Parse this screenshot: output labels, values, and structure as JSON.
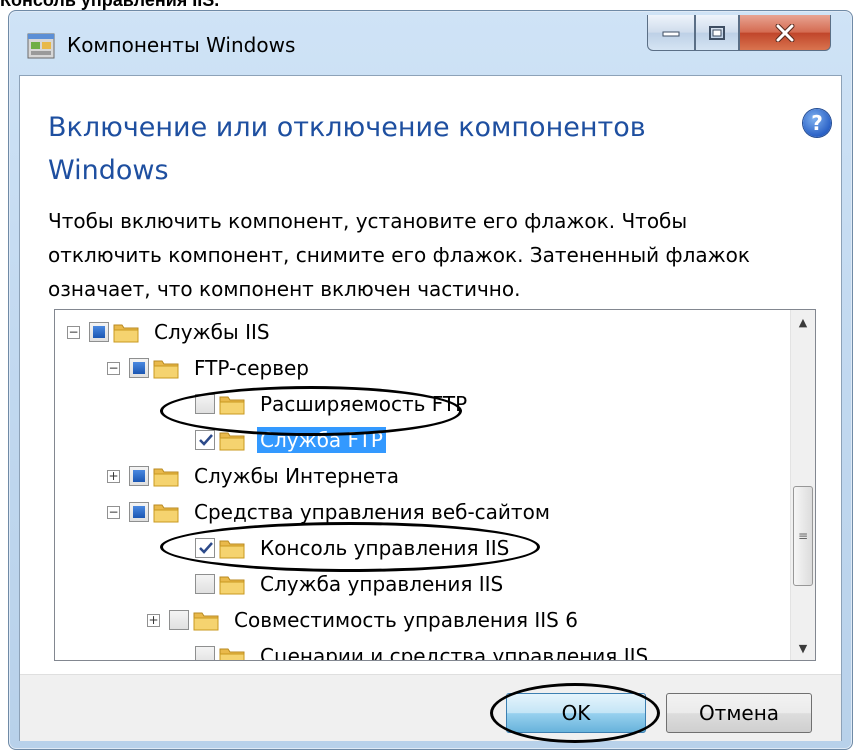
{
  "caption": "Консоль управления IIS.",
  "window": {
    "title": "Компоненты Windows",
    "heading_line1": "Включение или отключение компонентов",
    "heading_line2": "Windows",
    "description_line1": "Чтобы включить компонент, установите его флажок. Чтобы",
    "description_line2": "отключить компонент, снимите его флажок. Затененный флажок",
    "description_line3": "означает, что компонент включен частично.",
    "help_glyph": "?"
  },
  "tree": [
    {
      "label": "Службы IIS",
      "expander": "⊟",
      "state": "partial",
      "selected": false
    },
    {
      "label": "FTP-сервер",
      "expander": "⊟",
      "state": "partial",
      "selected": false
    },
    {
      "label": "Расширяемость FTP",
      "expander": "",
      "state": "unchecked",
      "selected": false
    },
    {
      "label": "Служба FTP",
      "expander": "",
      "state": "checked",
      "selected": true
    },
    {
      "label": "Службы Интернета",
      "expander": "⊞",
      "state": "partial",
      "selected": false
    },
    {
      "label": "Средства управления веб-сайтом",
      "expander": "⊟",
      "state": "partial",
      "selected": false
    },
    {
      "label": "Консоль управления IIS",
      "expander": "",
      "state": "checked",
      "selected": false
    },
    {
      "label": "Служба управления IIS",
      "expander": "",
      "state": "unchecked",
      "selected": false
    },
    {
      "label": "Совместимость управления IIS 6",
      "expander": "⊞",
      "state": "unchecked",
      "selected": false
    },
    {
      "label": "Сценарии и средства управления IIS",
      "expander": "",
      "state": "unchecked",
      "selected": false
    }
  ],
  "buttons": {
    "ok": "OK",
    "cancel": "Отмена"
  },
  "colors": {
    "heading": "#1e4fa0",
    "selection": "#3399ff",
    "checkbox_partial": "#1b57b3"
  },
  "icons": {
    "app": "windows-features-icon",
    "help": "help-icon",
    "folder": "folder-icon"
  }
}
